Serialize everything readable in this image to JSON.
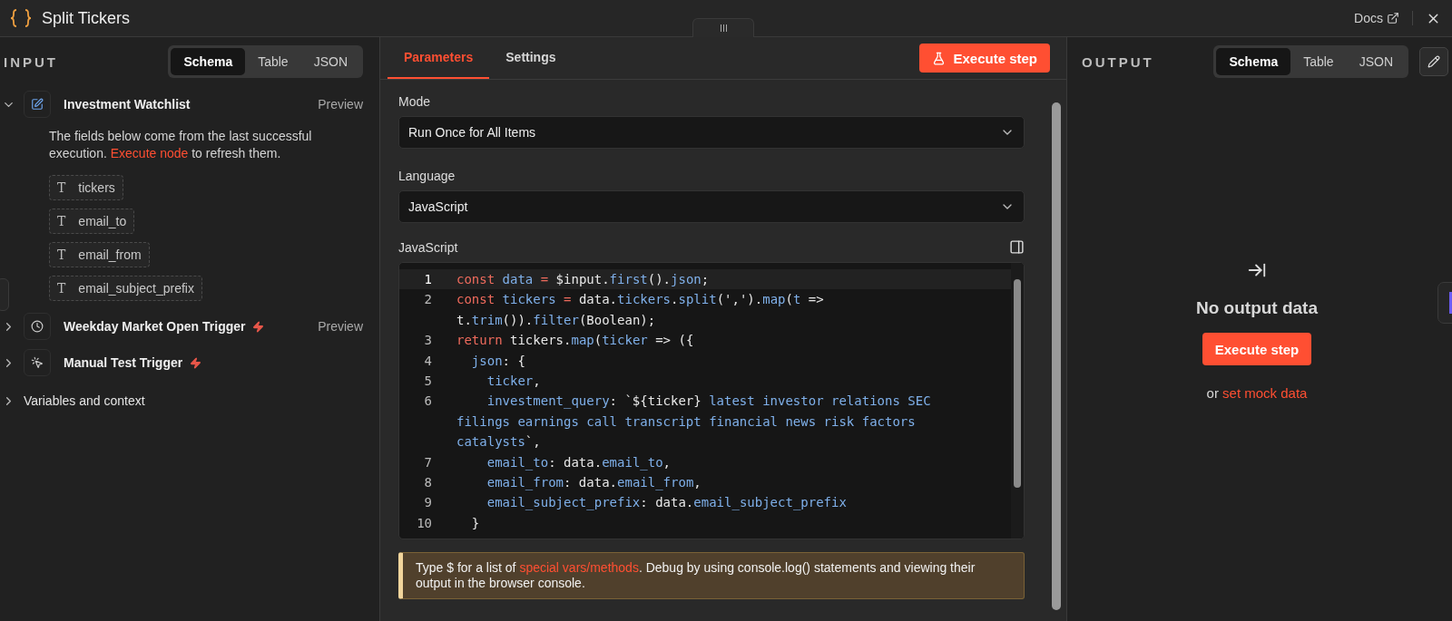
{
  "window": {
    "title": "Split Tickers",
    "docs_link": "Docs"
  },
  "input_panel": {
    "heading": "INPUT",
    "view_tabs": [
      {
        "label": "Schema",
        "selected": true
      },
      {
        "label": "Table",
        "selected": false
      },
      {
        "label": "JSON",
        "selected": false
      }
    ],
    "nodes": [
      {
        "name": "Investment Watchlist",
        "kind": "edit",
        "expanded": true,
        "trigger": false,
        "preview": "Preview",
        "notice": {
          "before": "The fields below come from the last successful execution. ",
          "link": "Execute node",
          "after": " to refresh them."
        },
        "fields": [
          {
            "type": "T",
            "name": "tickers"
          },
          {
            "type": "T",
            "name": "email_to"
          },
          {
            "type": "T",
            "name": "email_from"
          },
          {
            "type": "T",
            "name": "email_subject_prefix"
          }
        ]
      },
      {
        "name": "Weekday Market Open Trigger",
        "kind": "clock",
        "expanded": false,
        "trigger": true,
        "preview": "Preview"
      },
      {
        "name": "Manual Test Trigger",
        "kind": "pointer",
        "expanded": false,
        "trigger": true
      }
    ],
    "variables": {
      "label": "Variables and context",
      "expanded": false
    }
  },
  "editor": {
    "tabs": [
      {
        "label": "Parameters",
        "selected": true
      },
      {
        "label": "Settings",
        "selected": false
      }
    ],
    "execute_button": "Execute step",
    "mode": {
      "label": "Mode",
      "value": "Run Once for All Items"
    },
    "language": {
      "label": "Language",
      "value": "JavaScript"
    },
    "code": {
      "label": "JavaScript",
      "lines": [
        {
          "number": "1",
          "active": true,
          "tokens": [
            {
              "kind": "k",
              "text": "const "
            },
            {
              "kind": "v",
              "text": "data "
            },
            {
              "kind": "k",
              "text": "= "
            },
            {
              "kind": "p",
              "text": "$input."
            },
            {
              "kind": "v",
              "text": "first"
            },
            {
              "kind": "p",
              "text": "()."
            },
            {
              "kind": "v",
              "text": "json"
            },
            {
              "kind": "p",
              "text": ";"
            }
          ]
        },
        {
          "number": "2",
          "active": false,
          "tokens": [
            {
              "kind": "k",
              "text": "const "
            },
            {
              "kind": "v",
              "text": "tickers "
            },
            {
              "kind": "k",
              "text": "= "
            },
            {
              "kind": "p",
              "text": "data."
            },
            {
              "kind": "v",
              "text": "tickers"
            },
            {
              "kind": "p",
              "text": "."
            },
            {
              "kind": "v",
              "text": "split"
            },
            {
              "kind": "p",
              "text": "(',')."
            },
            {
              "kind": "v",
              "text": "map"
            },
            {
              "kind": "p",
              "text": "("
            },
            {
              "kind": "v",
              "text": "t"
            },
            {
              "kind": "p",
              "text": " => t."
            },
            {
              "kind": "v",
              "text": "trim"
            },
            {
              "kind": "p",
              "text": "())."
            },
            {
              "kind": "v",
              "text": "filter"
            },
            {
              "kind": "p",
              "text": "(Boolean);"
            }
          ]
        },
        {
          "number": "3",
          "active": false,
          "tokens": [
            {
              "kind": "k",
              "text": "return "
            },
            {
              "kind": "p",
              "text": "tickers."
            },
            {
              "kind": "v",
              "text": "map"
            },
            {
              "kind": "p",
              "text": "("
            },
            {
              "kind": "v",
              "text": "ticker"
            },
            {
              "kind": "p",
              "text": " => ({"
            }
          ]
        },
        {
          "number": "4",
          "active": false,
          "tokens": [
            {
              "kind": "v",
              "text": "  json"
            },
            {
              "kind": "p",
              "text": ": {"
            }
          ]
        },
        {
          "number": "5",
          "active": false,
          "tokens": [
            {
              "kind": "v",
              "text": "    ticker"
            },
            {
              "kind": "p",
              "text": ","
            }
          ]
        },
        {
          "number": "6",
          "active": false,
          "tokens": [
            {
              "kind": "v",
              "text": "    investment_query"
            },
            {
              "kind": "p",
              "text": ": `${ticker} "
            },
            {
              "kind": "v",
              "text": "latest investor relations SEC filings earnings call transcript financial news risk factors catalysts"
            },
            {
              "kind": "p",
              "text": "`,"
            }
          ]
        },
        {
          "number": "7",
          "active": false,
          "tokens": [
            {
              "kind": "v",
              "text": "    email_to"
            },
            {
              "kind": "p",
              "text": ": data."
            },
            {
              "kind": "v",
              "text": "email_to"
            },
            {
              "kind": "p",
              "text": ","
            }
          ]
        },
        {
          "number": "8",
          "active": false,
          "tokens": [
            {
              "kind": "v",
              "text": "    email_from"
            },
            {
              "kind": "p",
              "text": ": data."
            },
            {
              "kind": "v",
              "text": "email_from"
            },
            {
              "kind": "p",
              "text": ","
            }
          ]
        },
        {
          "number": "9",
          "active": false,
          "tokens": [
            {
              "kind": "v",
              "text": "    email_subject_prefix"
            },
            {
              "kind": "p",
              "text": ": data."
            },
            {
              "kind": "v",
              "text": "email_subject_prefix"
            }
          ]
        },
        {
          "number": "10",
          "active": false,
          "tokens": [
            {
              "kind": "p",
              "text": "  }"
            }
          ]
        }
      ]
    },
    "hint": {
      "before": "Type $ for a list of ",
      "link": "special vars/methods",
      "after": ". Debug by using console.log() statements and viewing their output in the browser console."
    }
  },
  "output_panel": {
    "heading": "OUTPUT",
    "view_tabs": [
      {
        "label": "Schema",
        "selected": true
      },
      {
        "label": "Table",
        "selected": false
      },
      {
        "label": "JSON",
        "selected": false
      }
    ],
    "empty": {
      "title": "No output data",
      "button": "Execute step",
      "prefix": "or ",
      "link": "set mock data"
    }
  }
}
